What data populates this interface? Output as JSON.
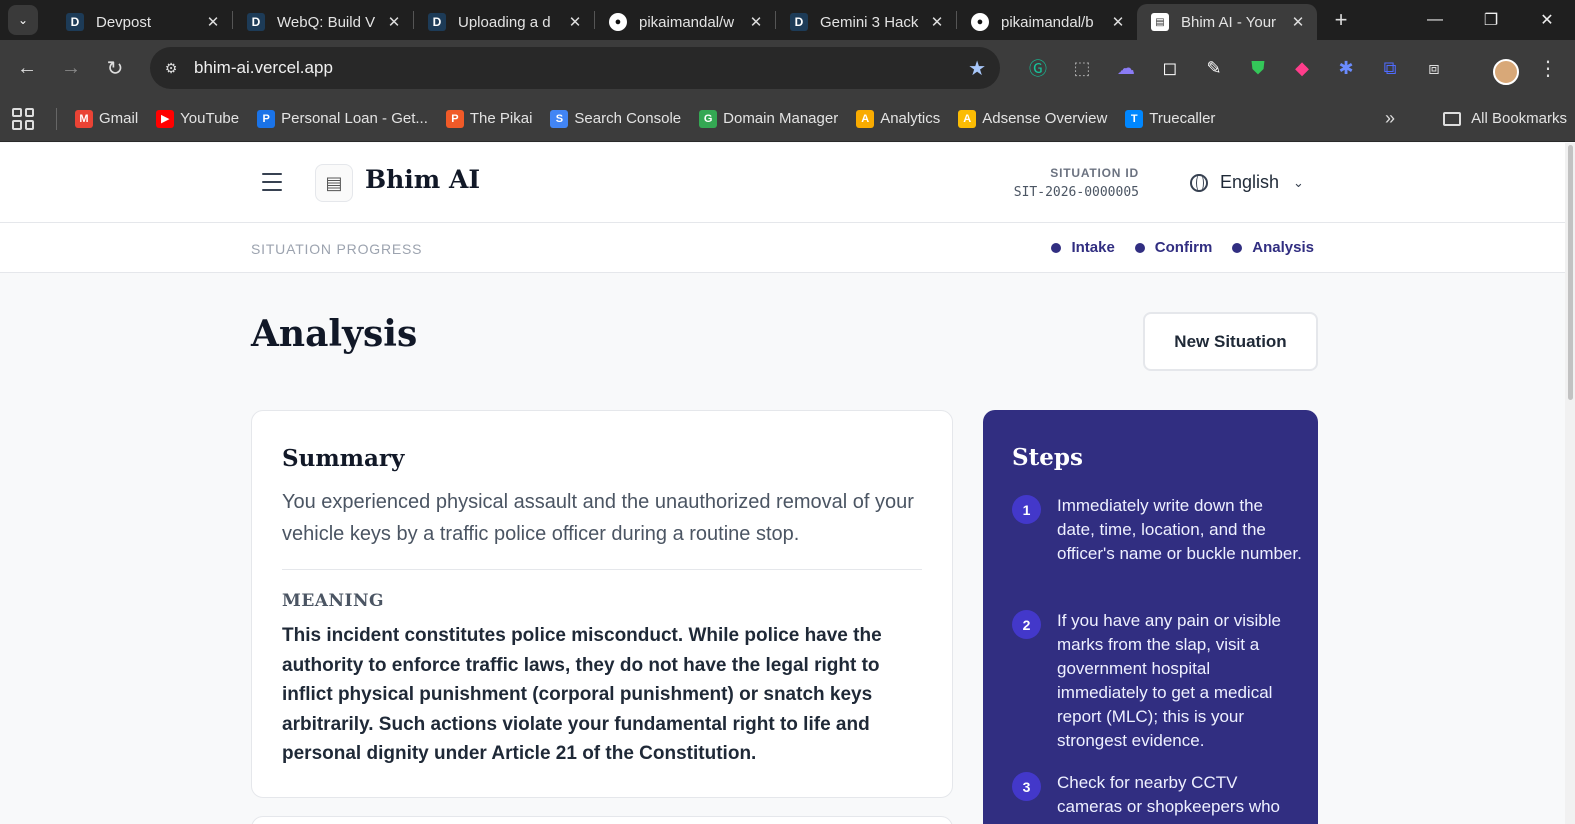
{
  "browser": {
    "tabs": [
      {
        "favicon": "D",
        "kind": "devpost",
        "title": "Devpost"
      },
      {
        "favicon": "D",
        "kind": "devpost",
        "title": "WebQ: Build V"
      },
      {
        "favicon": "D",
        "kind": "devpost",
        "title": "Uploading a d"
      },
      {
        "favicon": "",
        "kind": "github",
        "title": "pikaimandal/w"
      },
      {
        "favicon": "D",
        "kind": "devpost",
        "title": "Gemini 3 Hack"
      },
      {
        "favicon": "",
        "kind": "github",
        "title": "pikaimandal/b"
      },
      {
        "favicon": "",
        "kind": "bhim",
        "title": "Bhim AI - Your"
      }
    ],
    "url": "bhim-ai.vercel.app",
    "bookmarks": [
      {
        "label": "Gmail",
        "color": "#ea4335",
        "glyph": "M"
      },
      {
        "label": "YouTube",
        "color": "#ff0000",
        "glyph": "▶"
      },
      {
        "label": "Personal Loan - Get...",
        "color": "#1a73e8",
        "glyph": "P"
      },
      {
        "label": "The Pikai",
        "color": "#f05a28",
        "glyph": "P"
      },
      {
        "label": "Search Console",
        "color": "#4285f4",
        "glyph": "S"
      },
      {
        "label": "Domain Manager",
        "color": "#34a853",
        "glyph": "G"
      },
      {
        "label": "Analytics",
        "color": "#f9ab00",
        "glyph": "A"
      },
      {
        "label": "Adsense Overview",
        "color": "#fbbc04",
        "glyph": "A"
      },
      {
        "label": "Truecaller",
        "color": "#0087ff",
        "glyph": "T"
      }
    ],
    "all_bookmarks": "All Bookmarks"
  },
  "app": {
    "brand": "Bhim AI",
    "situation_id_label": "SITUATION ID",
    "situation_id": "SIT-2026-0000005",
    "language": "English",
    "progress_label": "SITUATION PROGRESS",
    "progress_steps": [
      "Intake",
      "Confirm",
      "Analysis"
    ],
    "page_title": "Analysis",
    "new_situation": "New Situation",
    "summary": {
      "heading": "Summary",
      "text": "You experienced physical assault and the unauthorized removal of your vehicle keys by a traffic police officer during a routine stop.",
      "meaning_label": "MEANING",
      "meaning_text": "This incident constitutes police misconduct. While police have the authority to enforce traffic laws, they do not have the legal right to inflict physical punishment (corporal punishment) or snatch keys arbitrarily. Such actions violate your fundamental right to life and personal dignity under Article 21 of the Constitution."
    },
    "steps": {
      "heading": "Steps",
      "items": [
        {
          "num": "1",
          "text": "Immediately write down the date, time, location, and the officer's name or buckle number."
        },
        {
          "num": "2",
          "text": "If you have any pain or visible marks from the slap, visit a government hospital immediately to get a medical report (MLC); this is your strongest evidence."
        },
        {
          "num": "3",
          "text": "Check for nearby CCTV cameras or shopkeepers who"
        }
      ]
    }
  },
  "colors": {
    "primary": "#312e81",
    "accent": "#4338ca"
  }
}
